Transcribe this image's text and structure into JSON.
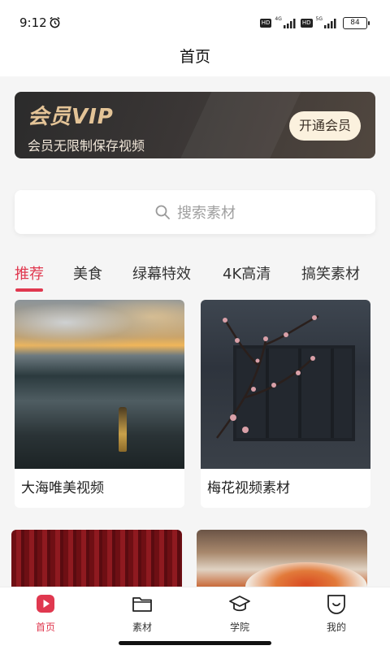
{
  "status_bar": {
    "time": "9:12",
    "network_1": "4G",
    "network_2": "5G",
    "hd_label": "HD",
    "battery": "84"
  },
  "header": {
    "title": "首页"
  },
  "vip_banner": {
    "title": "会员VIP",
    "subtitle": "会员无限制保存视频",
    "button_label": "开通会员"
  },
  "search": {
    "placeholder": "搜索素材"
  },
  "categories": {
    "active_index": 0,
    "items": [
      "推荐",
      "美食",
      "绿幕特效",
      "4K高清",
      "搞笑素材"
    ]
  },
  "cards": [
    {
      "title": "大海唯美视频"
    },
    {
      "title": "梅花视频素材"
    }
  ],
  "bottom_nav": {
    "active_index": 0,
    "items": [
      {
        "label": "首页",
        "icon": "play-icon"
      },
      {
        "label": "素材",
        "icon": "folder-icon"
      },
      {
        "label": "学院",
        "icon": "graduation-cap-icon"
      },
      {
        "label": "我的",
        "icon": "smile-icon"
      }
    ]
  },
  "colors": {
    "accent": "#e0384f",
    "vip_gold": "#e4c497",
    "vip_button": "#fbf1de"
  }
}
